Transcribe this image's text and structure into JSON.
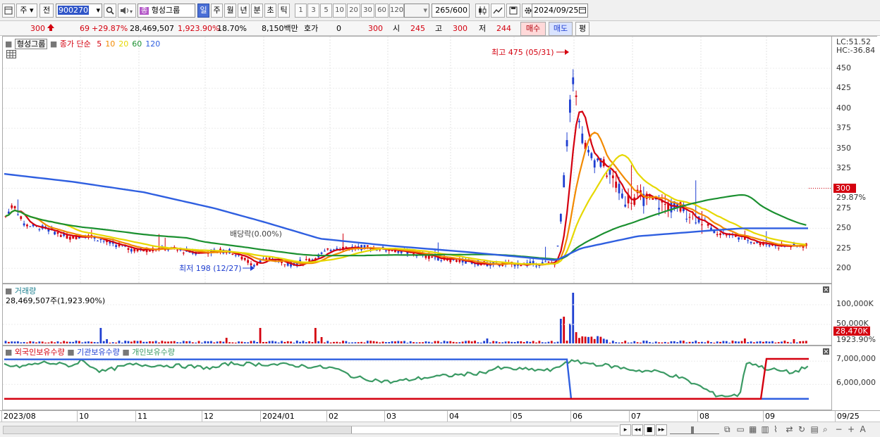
{
  "toolbar": {
    "market": "주",
    "view": "전",
    "stock_code": "900270",
    "stock_name": "형성그룹",
    "stock_badge": "종",
    "period_tabs": [
      "일",
      "주",
      "월",
      "년",
      "분",
      "초",
      "틱"
    ],
    "intervals": [
      "1",
      "3",
      "5",
      "10",
      "20",
      "30",
      "60",
      "120"
    ],
    "count": "265",
    "count_total": "/600",
    "date": "2024/09/25"
  },
  "quote": {
    "price": "300",
    "change": "69",
    "change_pct": "+29.87%",
    "volume": "28,469,507",
    "volume_pct": "1,923.90%",
    "turnover": "18.70%",
    "amount": "8,150백만",
    "bid_label": "호가",
    "bid_value": "0",
    "bid_price": "300",
    "open_label": "시",
    "open": "245",
    "high_label": "고",
    "high": "300",
    "low_label": "저",
    "low": "244",
    "buy_label": "매수",
    "sell_label": "매도",
    "eval_label": "평"
  },
  "price_panel": {
    "stock_label": "형성그룹",
    "ma_label": "종가 단순",
    "ma_periods": [
      "5",
      "10",
      "20",
      "60",
      "120"
    ],
    "lc": "LC:51.52",
    "hc": "HC:-36.84",
    "high_annotation": "최고 475 (05/31)",
    "low_annotation": "최저 198 (12/27)",
    "dividend_annotation": "배당락(0.00%)",
    "current_price": "300",
    "current_pct": "29.87%"
  },
  "volume_panel": {
    "title": "거래량",
    "value": "28,469,507주(1,923.90%)",
    "axis_labels": [
      "100,000K",
      "50,000K"
    ],
    "current_volume": "28,470K",
    "current_pct": "1923.90%"
  },
  "holdings_panel": {
    "legend": [
      "외국인보유수량",
      "기관보유수량",
      "개인보유수량"
    ],
    "axis_labels": [
      "7,000,000",
      "6,000,000"
    ]
  },
  "date_axis": [
    "2023/08",
    "10",
    "11",
    "12",
    "2024/01",
    "02",
    "03",
    "04",
    "05",
    "06",
    "07",
    "08",
    "09",
    "09/25"
  ],
  "chart_data": {
    "type": "line",
    "price_axis_ticks": [
      450,
      425,
      400,
      375,
      350,
      325,
      300,
      275,
      250,
      225,
      200
    ],
    "price_range": [
      185,
      470
    ],
    "annotations": [
      {
        "label": "최고",
        "value": 475,
        "date": "05/31"
      },
      {
        "label": "최저",
        "value": 198,
        "date": "12/27"
      }
    ],
    "series": [
      {
        "name": "5",
        "color": "#d4000f"
      },
      {
        "name": "10",
        "color": "#f28a00"
      },
      {
        "name": "20",
        "color": "#f5e300"
      },
      {
        "name": "60",
        "color": "#1b9030"
      },
      {
        "name": "120",
        "color": "#2f5fe0"
      }
    ],
    "holdings_series": [
      {
        "name": "외국인보유수량",
        "color": "#d4000f"
      },
      {
        "name": "기관보유수량",
        "color": "#2f5fe0"
      },
      {
        "name": "개인보유수량",
        "color": "#3b9a64"
      }
    ],
    "last_close": 300,
    "last_volume_k": 28470
  }
}
